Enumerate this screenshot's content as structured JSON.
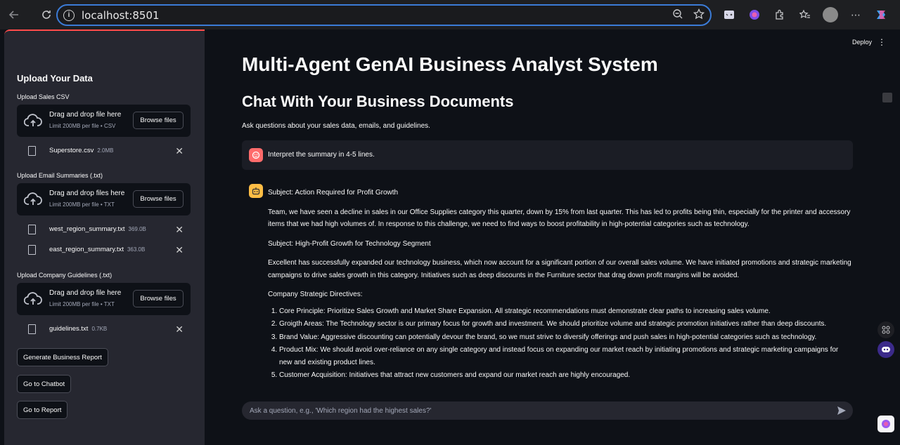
{
  "browser": {
    "url": "localhost:8501"
  },
  "header": {
    "deploy_label": "Deploy"
  },
  "sidebar": {
    "title": "Upload Your Data",
    "sections": [
      {
        "label": "Upload Sales CSV",
        "drop_text": "Drag and drop file here",
        "limit_text": "Limit 200MB per file • CSV",
        "browse_label": "Browse files",
        "files": [
          {
            "name": "Superstore.csv",
            "size": "2.0MB"
          }
        ]
      },
      {
        "label": "Upload Email Summaries (.txt)",
        "drop_text": "Drag and drop files here",
        "limit_text": "Limit 200MB per file • TXT",
        "browse_label": "Browse files",
        "files": [
          {
            "name": "west_region_summary.txt",
            "size": "369.0B"
          },
          {
            "name": "east_region_summary.txt",
            "size": "363.0B"
          }
        ]
      },
      {
        "label": "Upload Company Guidelines (.txt)",
        "drop_text": "Drag and drop file here",
        "limit_text": "Limit 200MB per file • TXT",
        "browse_label": "Browse files",
        "files": [
          {
            "name": "guidelines.txt",
            "size": "0.7KB"
          }
        ]
      }
    ],
    "buttons": [
      "Generate Business Report",
      "Go to Chatbot",
      "Go to Report"
    ]
  },
  "main": {
    "title": "Multi-Agent GenAI Business Analyst System",
    "subtitle": "Chat With Your Business Documents",
    "caption": "Ask questions about your sales data, emails, and guidelines.",
    "user_message": "Interpret the summary in 4-5 lines.",
    "assistant": {
      "subject1": "Subject: Action Required for Profit Growth",
      "para1": "Team, we have seen a decline in sales in our Office Supplies category this quarter, down by 15% from last quarter. This has led to profits being thin, especially for the printer and accessory items that we had high volumes of. In response to this challenge, we need to find ways to boost profitability in high-potential categories such as technology.",
      "subject2": "Subject: High-Profit Growth for Technology Segment",
      "para2": "Excellent has successfully expanded our technology business, which now account for a significant portion of our overall sales volume. We have initiated promotions and strategic marketing campaigns to drive sales growth in this category. Initiatives such as deep discounts in the Furniture sector that drag down profit margins will be avoided.",
      "directives_heading": "Company Strategic Directives:",
      "directives": [
        "Core Principle: Prioritize Sales Growth and Market Share Expansion. All strategic recommendations must demonstrate clear paths to increasing sales volume.",
        "Groigth Areas: The Technology sector is our primary focus for growth and investment. We should prioritize volume and strategic promotion initiatives rather than deep discounts.",
        "Brand Value: Aggressive discounting can potentially devour the brand, so we must strive to diversify offerings and push sales in high-potential categories such as technology.",
        "Product Mix: We should avoid over-reliance on any single category and instead focus on expanding our market reach by initiating promotions and strategic marketing campaigns for new and existing product lines.",
        "Customer Acquisition: Initiatives that attract new customers and expand our market reach are highly encouraged."
      ]
    },
    "chat_placeholder": "Ask a question, e.g., 'Which region had the highest sales?'"
  },
  "colors": {
    "accent": "#ff4b4b",
    "user_avatar": "#ff6b6b",
    "bot_avatar": "#ffbd45",
    "sidebar_bg": "#262730",
    "main_bg": "#0e1117"
  }
}
